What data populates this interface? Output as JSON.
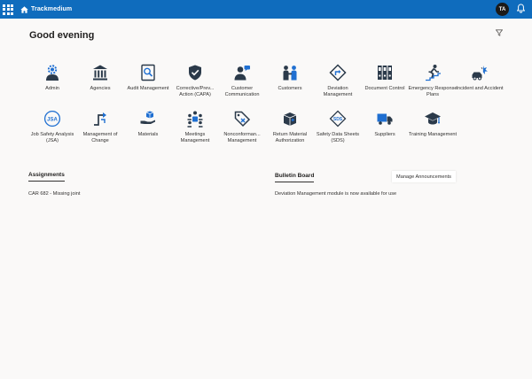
{
  "app": {
    "name": "Trackmedium",
    "avatar_initials": "TA"
  },
  "colors": {
    "brand": "#0f6cbd",
    "icon_dark": "#2b3a4a",
    "icon_accent": "#1f6fd1"
  },
  "header": {
    "greeting": "Good evening"
  },
  "modules": [
    {
      "label": "Admin",
      "icon": "admin-gear-person-icon"
    },
    {
      "label": "Agencies",
      "icon": "bank-building-icon"
    },
    {
      "label": "Audit Management",
      "icon": "audit-magnifier-icon"
    },
    {
      "label": "Corrective/Prev... Action (CAPA)",
      "icon": "shield-check-icon"
    },
    {
      "label": "Customer Communication",
      "icon": "person-chat-icon"
    },
    {
      "label": "Customers",
      "icon": "people-handshake-icon"
    },
    {
      "label": "Deviation Management",
      "icon": "diamond-arrow-icon"
    },
    {
      "label": "Document Control",
      "icon": "binders-icon"
    },
    {
      "label": "Emergency Response Plans",
      "icon": "emergency-exit-icon"
    },
    {
      "label": "Incident and Accident",
      "icon": "car-crash-icon"
    },
    {
      "label": "Job Safety Analysis (JSA)",
      "icon": "jsa-badge-icon"
    },
    {
      "label": "Management of Change",
      "icon": "change-arrows-icon"
    },
    {
      "label": "Materials",
      "icon": "hand-box-icon"
    },
    {
      "label": "Meetings Management",
      "icon": "meeting-people-icon"
    },
    {
      "label": "Nonconforman... Management",
      "icon": "tag-cross-icon"
    },
    {
      "label": "Return Material Authorization",
      "icon": "box-return-icon"
    },
    {
      "label": "Safety Data Sheets (SDS)",
      "icon": "sds-badge-icon"
    },
    {
      "label": "Suppliers",
      "icon": "delivery-truck-icon"
    },
    {
      "label": "Training Management",
      "icon": "graduation-cap-icon"
    }
  ],
  "assignments": {
    "title": "Assignments",
    "items": [
      "CAR 682 - Missing joint"
    ]
  },
  "bulletin": {
    "title": "Bulletin Board",
    "manage_label": "Manage Announcements",
    "items": [
      "Deviation Management module is now available for use"
    ]
  }
}
